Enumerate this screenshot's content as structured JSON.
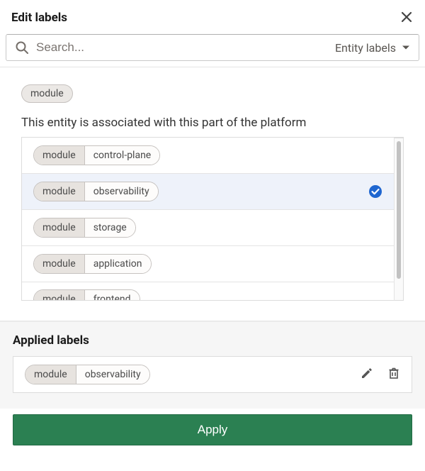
{
  "dialog": {
    "title": "Edit labels"
  },
  "search": {
    "placeholder": "Search...",
    "filter_label": "Entity labels"
  },
  "query": {
    "key": "module",
    "description": "This entity is associated with this part of the platform"
  },
  "options": [
    {
      "key": "module",
      "value": "control-plane",
      "selected": false
    },
    {
      "key": "module",
      "value": "observability",
      "selected": true
    },
    {
      "key": "module",
      "value": "storage",
      "selected": false
    },
    {
      "key": "module",
      "value": "application",
      "selected": false
    },
    {
      "key": "module",
      "value": "frontend",
      "selected": false
    }
  ],
  "applied": {
    "title": "Applied labels",
    "items": [
      {
        "key": "module",
        "value": "observability"
      }
    ]
  },
  "footer": {
    "apply_label": "Apply"
  },
  "colors": {
    "primary_button": "#2b8052",
    "selection_check": "#1f66d0",
    "chip_bg": "#e7e3df"
  }
}
